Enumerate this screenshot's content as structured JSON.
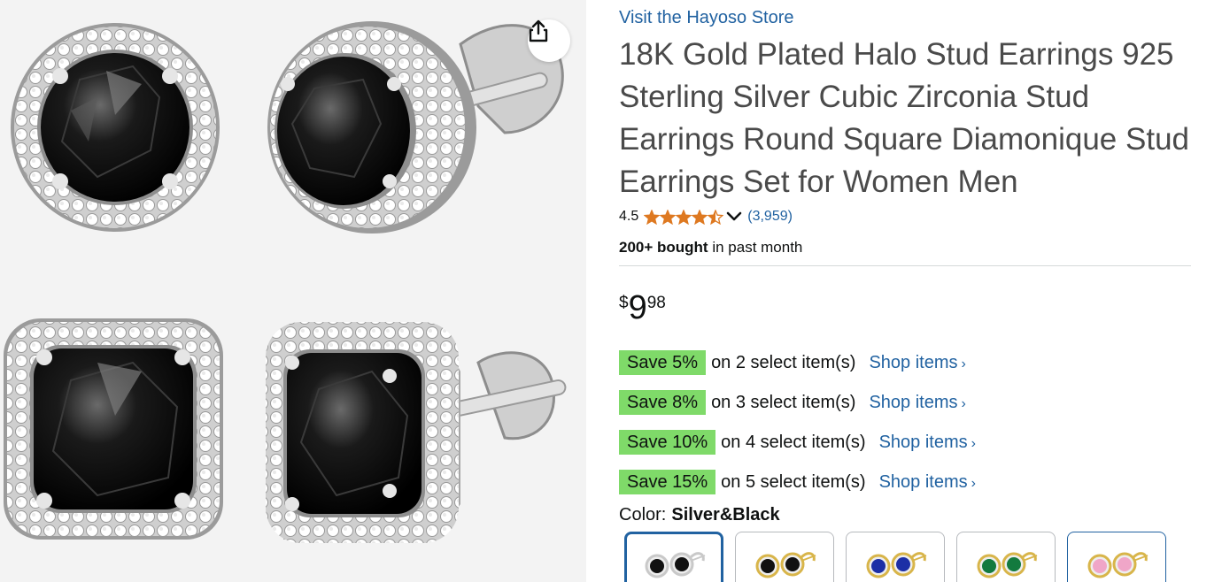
{
  "store_link": "Visit the Hayoso Store",
  "title": "18K Gold Plated Halo Stud Earrings 925 Sterling Silver Cubic Zirconia Stud Earrings Round Square Diamonique Stud Earrings Set for Women Men",
  "rating": {
    "value": "4.5",
    "stars": 4.5,
    "count": "(3,959)"
  },
  "bought": {
    "bold": "200+ bought",
    "rest": " in past month"
  },
  "price": {
    "symbol": "$",
    "whole": "9",
    "fraction": "98"
  },
  "promotions": [
    {
      "badge": "Save 5%",
      "text": "on 2 select item(s)",
      "link": "Shop items",
      "arrow": "›"
    },
    {
      "badge": "Save 8%",
      "text": "on 3 select item(s)",
      "link": "Shop items",
      "arrow": "›"
    },
    {
      "badge": "Save 10%",
      "text": "on 4 select item(s)",
      "link": "Shop items",
      "arrow": "›"
    },
    {
      "badge": "Save 15%",
      "text": "on 5 select item(s)",
      "link": "Shop items",
      "arrow": "›"
    }
  ],
  "color": {
    "label": "Color:",
    "value": "Silver&Black"
  },
  "swatches": [
    {
      "stone": "#111111",
      "metal": "#c9c9c9",
      "state": "selected"
    },
    {
      "stone": "#111111",
      "metal": "#d8b54a",
      "state": "normal"
    },
    {
      "stone": "#1c2fa6",
      "metal": "#d8b54a",
      "state": "normal"
    },
    {
      "stone": "#137a3e",
      "metal": "#d8b54a",
      "state": "normal"
    },
    {
      "stone": "#f0a6c8",
      "metal": "#d8b54a",
      "state": "hover"
    }
  ],
  "icons": {
    "share": "share-icon",
    "star": "star-icon",
    "chevron": "chevron-down-icon"
  },
  "colors": {
    "link": "#2162a1",
    "star": "#de7921",
    "promo_badge": "#7fda69",
    "title": "#4a4a4a"
  }
}
